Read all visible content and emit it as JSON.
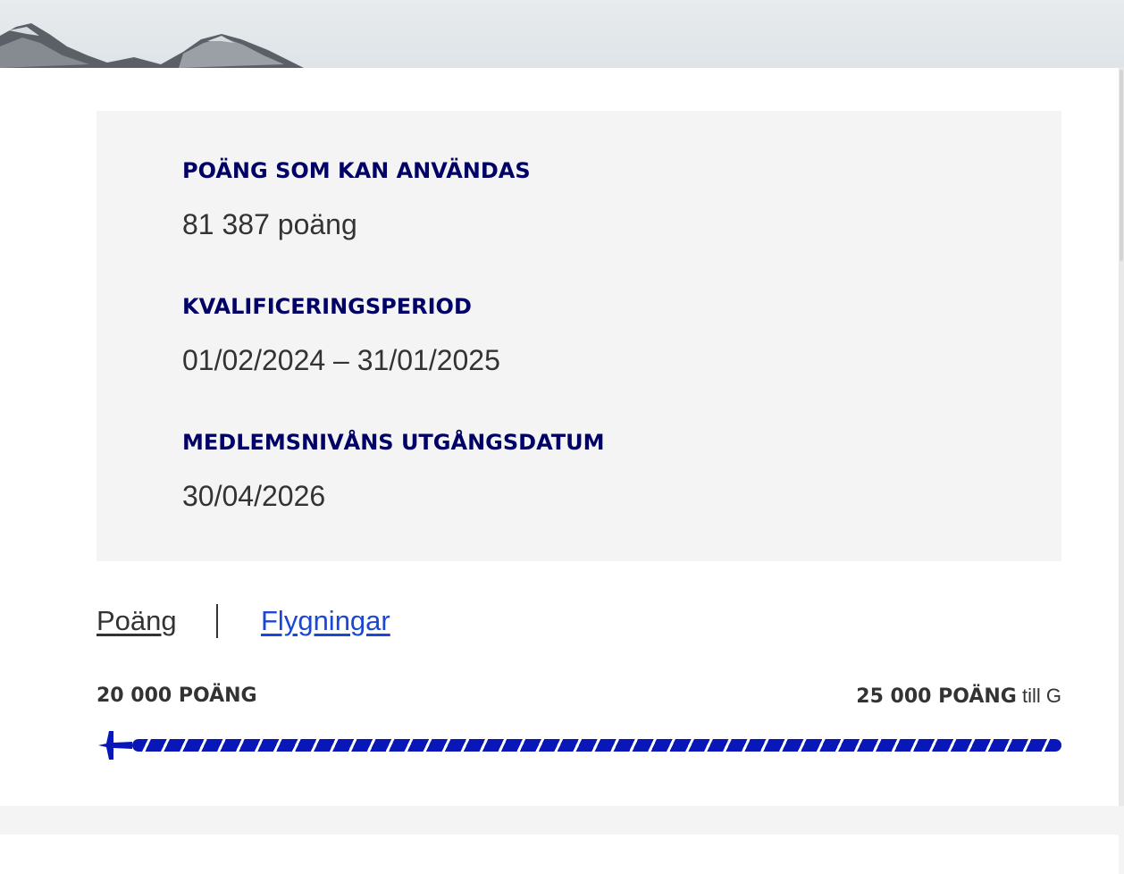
{
  "info": {
    "points_label": "POÄNG SOM KAN ANVÄNDAS",
    "points_value": "81 387 poäng",
    "period_label": "KVALIFICERINGSPERIOD",
    "period_value": "01/02/2024 – 31/01/2025",
    "expiry_label": "MEDLEMSNIVÅNS UTGÅNGSDATUM",
    "expiry_value": "30/04/2026"
  },
  "tabs": {
    "points": "Poäng",
    "flights": "Flygningar"
  },
  "progress": {
    "current_label": "20 000 POÄNG",
    "target_label": "25 000 POÄNG",
    "target_suffix": " till G",
    "fraction": 1.0,
    "bar_color": "#0a17b8"
  },
  "colors": {
    "heading": "#000066",
    "link": "#1a47d6",
    "text": "#333333"
  },
  "icons": {
    "plane": "plane-icon"
  }
}
